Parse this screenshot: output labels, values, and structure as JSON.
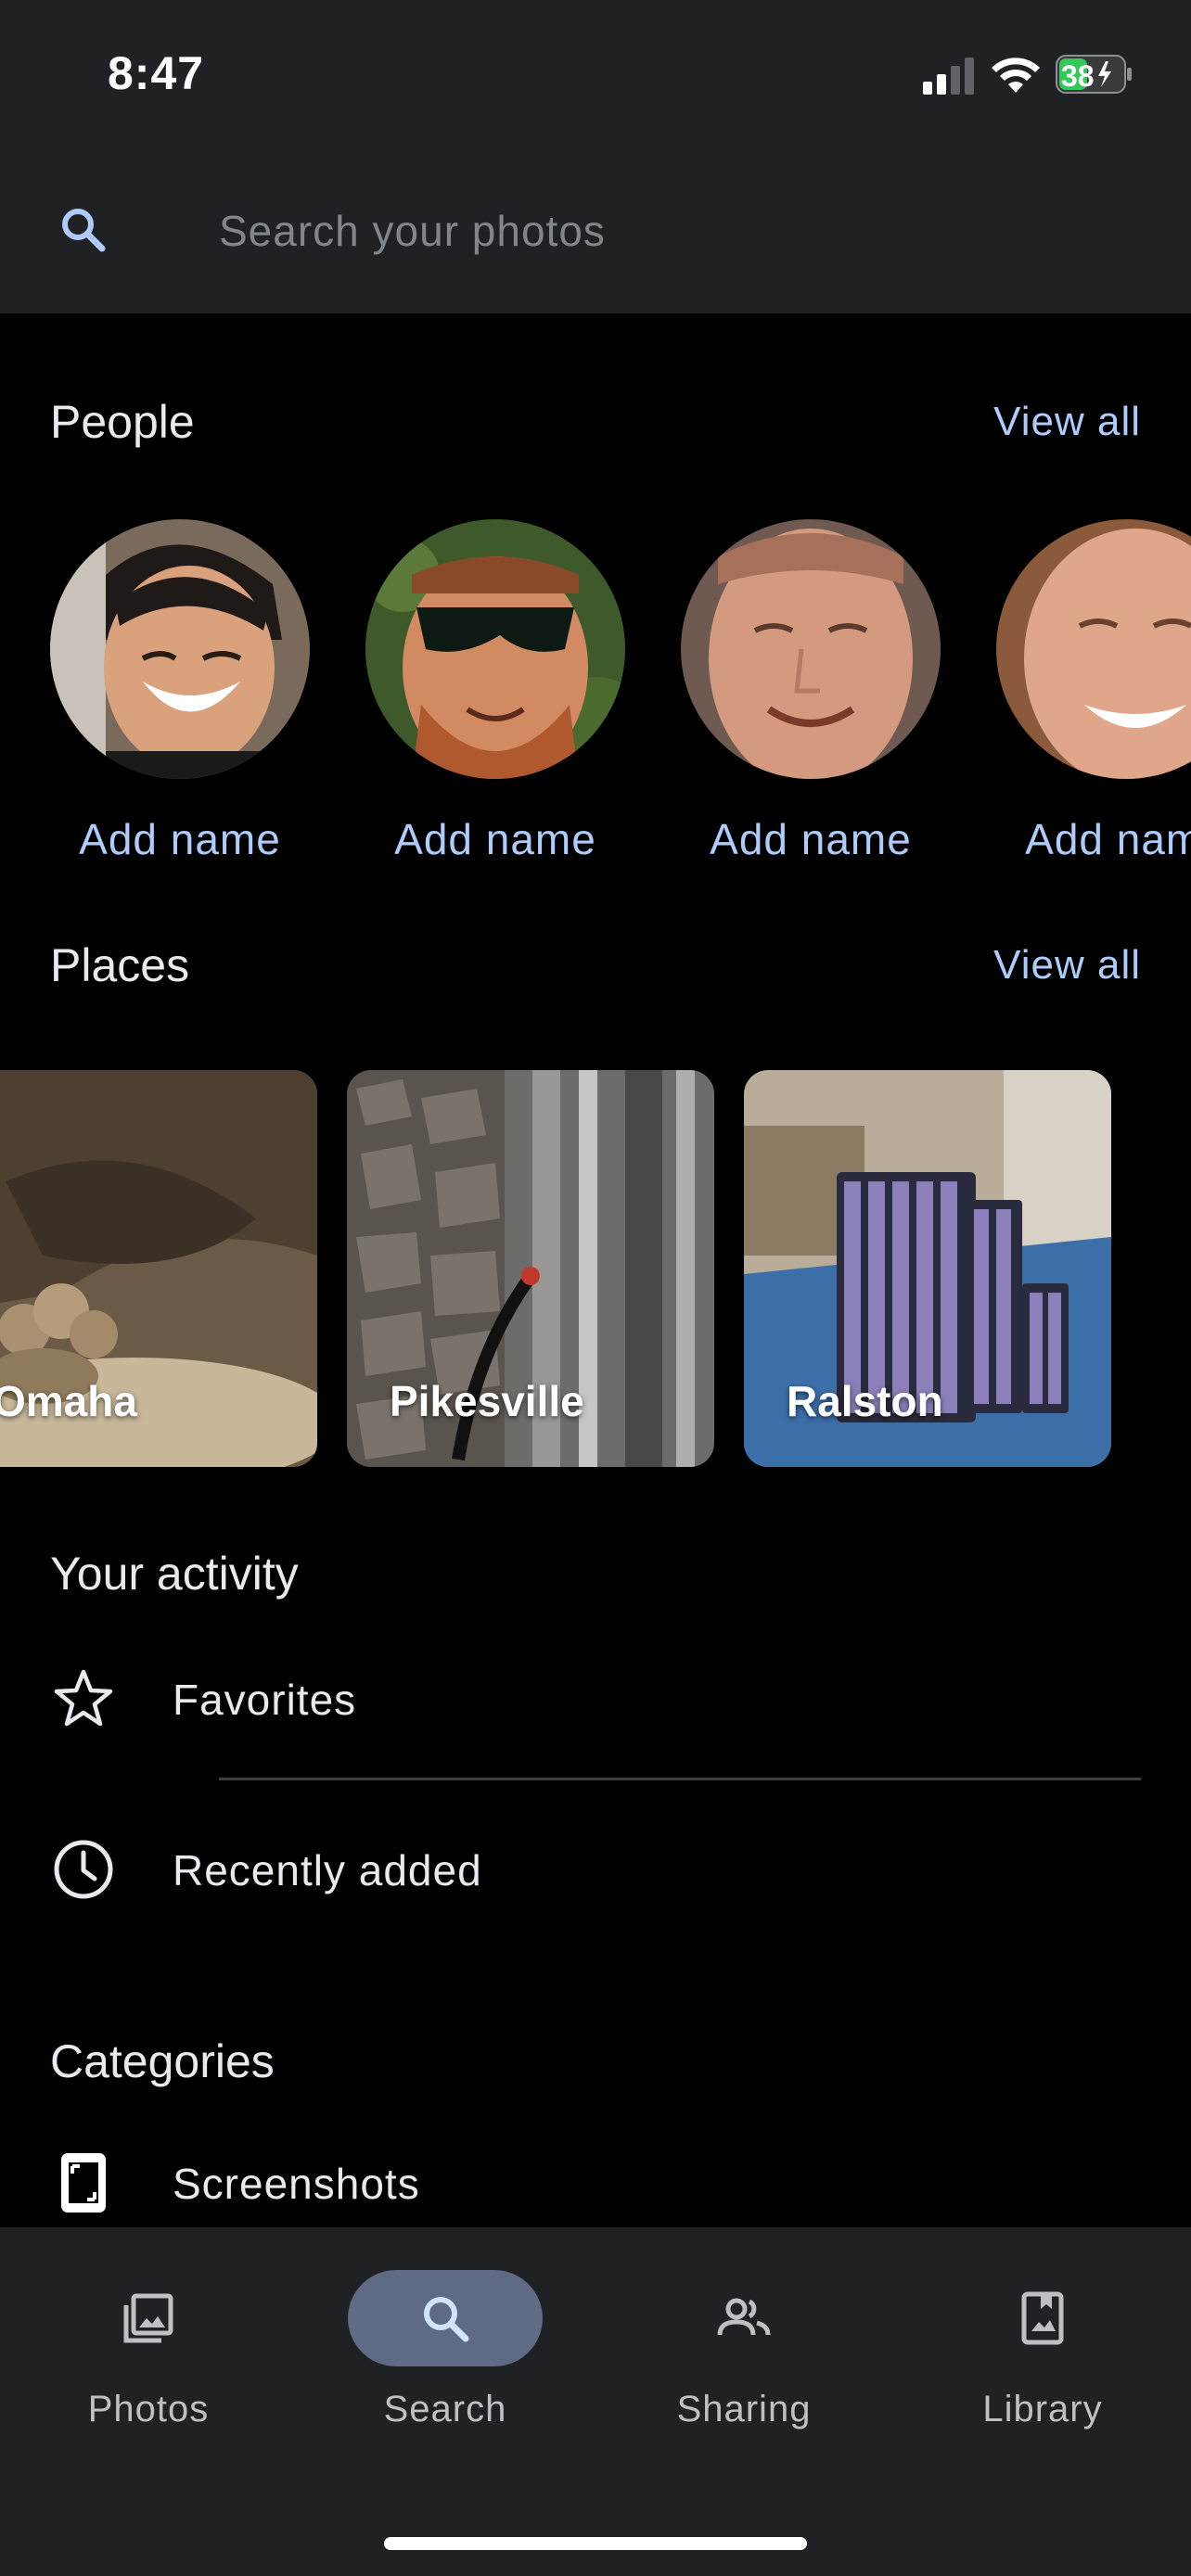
{
  "status_bar": {
    "time": "8:47",
    "battery": "38"
  },
  "search": {
    "placeholder": "Search your photos"
  },
  "people": {
    "title": "People",
    "view_all": "View all",
    "items": [
      {
        "label": "Add name"
      },
      {
        "label": "Add name"
      },
      {
        "label": "Add name"
      },
      {
        "label": "Add name"
      }
    ]
  },
  "places": {
    "title": "Places",
    "view_all": "View all",
    "items": [
      {
        "label": "Omaha"
      },
      {
        "label": "Pikesville"
      },
      {
        "label": "Ralston"
      }
    ]
  },
  "activity": {
    "title": "Your activity",
    "items": [
      {
        "label": "Favorites",
        "icon": "star-icon"
      },
      {
        "label": "Recently added",
        "icon": "clock-icon"
      }
    ]
  },
  "categories": {
    "title": "Categories",
    "items": [
      {
        "label": "Screenshots",
        "icon": "phone-screenshot-icon"
      }
    ]
  },
  "bottom_nav": {
    "items": [
      {
        "label": "Photos",
        "icon": "photos-icon",
        "active": false
      },
      {
        "label": "Search",
        "icon": "search-icon",
        "active": true
      },
      {
        "label": "Sharing",
        "icon": "people-icon",
        "active": false
      },
      {
        "label": "Library",
        "icon": "library-icon",
        "active": false
      }
    ]
  },
  "colors": {
    "accent": "#aecbfa",
    "header_bg": "#202124",
    "page_bg": "#000000",
    "active_pill": "#5f6b84",
    "battery_green": "#34c759"
  }
}
